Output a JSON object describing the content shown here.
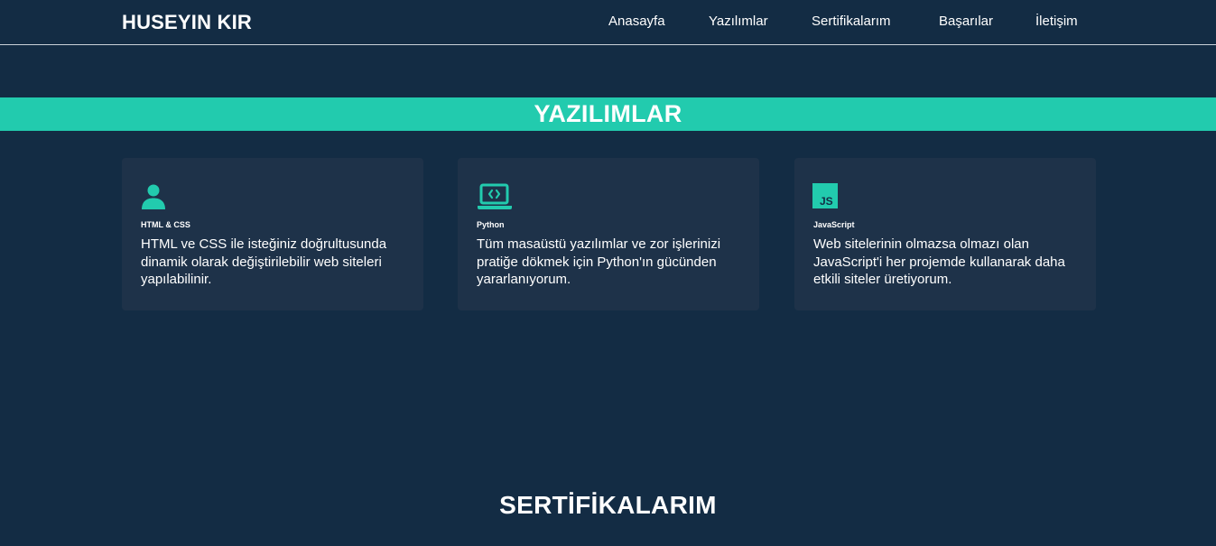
{
  "header": {
    "brand": "HUSEYIN KIR",
    "nav": [
      {
        "label": "Anasayfa"
      },
      {
        "label": "Yazılımlar"
      },
      {
        "label": "Sertifikalarım"
      },
      {
        "label": "Başarılar"
      },
      {
        "label": "İletişim"
      }
    ]
  },
  "software_section": {
    "title": "YAZILIMLAR",
    "cards": [
      {
        "icon": "user-icon",
        "title": "HTML & CSS",
        "text": "HTML ve CSS ile isteğiniz doğrultusunda dinamik olarak değiştirilebilir web siteleri yapılabilinir."
      },
      {
        "icon": "laptop-code-icon",
        "title": "Python",
        "text": "Tüm masaüstü yazılımlar ve zor işlerinizi pratiğe dökmek için Python'ın gücünden yararlanıyorum."
      },
      {
        "icon": "js-icon",
        "title": "JavaScript",
        "text": "Web sitelerinin olmazsa olmazı olan JavaScript'i her projemde kullanarak daha etkili siteler üretiyorum."
      }
    ]
  },
  "certificates_section": {
    "title": "SERTİFİKALARIM"
  },
  "colors": {
    "background": "#132c44",
    "card": "#1e3249",
    "accent": "#22cbae",
    "text": "#ffffff"
  }
}
